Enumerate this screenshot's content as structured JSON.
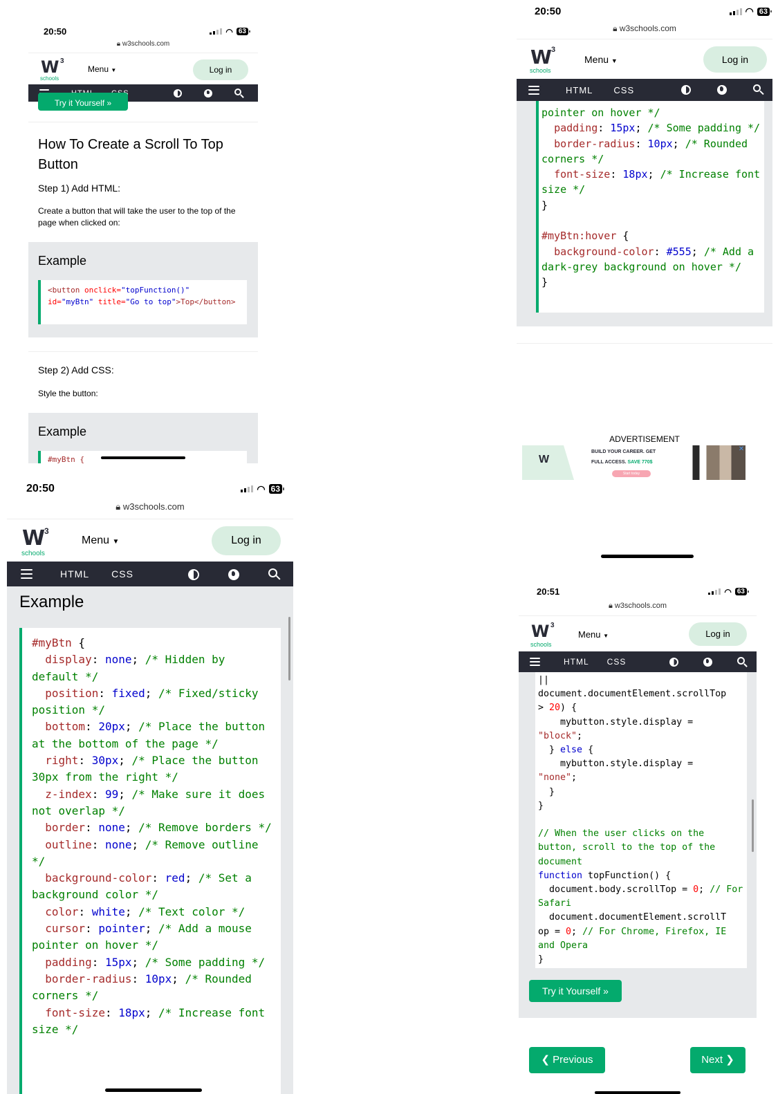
{
  "common": {
    "url": "w3schools.com",
    "menu_label": "Menu",
    "login_label": "Log in",
    "nav_html": "HTML",
    "nav_css": "CSS",
    "logo_schools": "schools",
    "logo_sup": "3"
  },
  "shot1": {
    "time": "20:50",
    "battery": "63",
    "cut_button": "Try it Yourself »",
    "title": "How To Create a Scroll To Top Button",
    "step1": "Step 1) Add HTML:",
    "desc1": "Create a button that will take the user to the top of the page when clicked on:",
    "example1": "Example",
    "code1_tag_open": "<button",
    "code1_attr1": " onclick=",
    "code1_val1": "\"topFunction()\"",
    "code1_attr2": "id=",
    "code1_val2": "\"myBtn\"",
    "code1_attr3": " title=",
    "code1_val3": "\"Go to top\"",
    "code1_text": ">Top</button>",
    "step2": "Step 2) Add CSS:",
    "desc2": "Style the button:",
    "example2": "Example",
    "code2_cut": "#myBtn {"
  },
  "shot2": {
    "time": "20:50",
    "battery": "63",
    "ad_label": "ADVERTISEMENT",
    "ad_line1": "BUILD YOUR CAREER. GET",
    "ad_line2": "FULL ACCESS.",
    "ad_save": "SAVE 770$",
    "ad_cta": "Start today",
    "ad_close": "✕"
  },
  "shot3": {
    "time": "20:50",
    "battery": "63",
    "example": "Example"
  },
  "shot4": {
    "time": "20:51",
    "battery": "63",
    "try_label": "Try it Yourself »",
    "prev_label": "❮ Previous",
    "next_label": "Next ❯"
  }
}
